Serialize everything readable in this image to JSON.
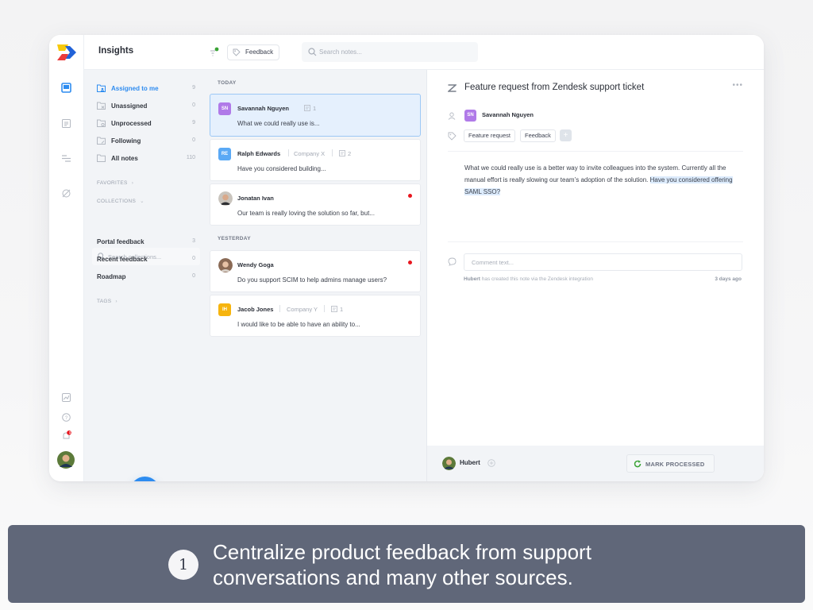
{
  "header": {
    "title": "Insights",
    "filter_chip_label": "Feedback",
    "search_placeholder": "Search notes..."
  },
  "rail": {
    "icons": [
      "inbox-icon",
      "note-icon",
      "roadmap-icon",
      "portal-icon",
      "analytics-icon",
      "help-icon",
      "notifications-icon"
    ],
    "notification_badge": "1"
  },
  "sidebar": {
    "items": [
      {
        "label": "Assigned to me",
        "count": "9",
        "icon": "folder-user-icon",
        "active": true
      },
      {
        "label": "Unassigned",
        "count": "0",
        "icon": "folder-x-icon"
      },
      {
        "label": "Unprocessed",
        "count": "9",
        "icon": "folder-circle-icon"
      },
      {
        "label": "Following",
        "count": "0",
        "icon": "folder-follow-icon"
      },
      {
        "label": "All notes",
        "count": "110",
        "icon": "folder-icon"
      }
    ],
    "favorites_label": "FAVORITES",
    "collections_label": "COLLECTIONS",
    "collections_search_placeholder": "Search collections...",
    "collections": [
      {
        "label": "Portal feedback",
        "count": "3"
      },
      {
        "label": "Recent feedback",
        "count": "0"
      },
      {
        "label": "Roadmap",
        "count": "0"
      }
    ],
    "tags_label": "TAGS",
    "add_button_label": "+"
  },
  "notes": {
    "groups": [
      {
        "label": "TODAY",
        "items": [
          {
            "initials": "SN",
            "avatar_color": "#b07ae8",
            "name": "Savannah Nguyen",
            "company": "",
            "note_count": "1",
            "snippet": "What we could really use is...",
            "selected": true,
            "unread": false
          },
          {
            "initials": "RE",
            "avatar_color": "#5aa9f5",
            "name": "Ralph Edwards",
            "company": "Company X",
            "note_count": "2",
            "snippet": "Have you considered building...",
            "selected": false,
            "unread": false
          },
          {
            "initials": "",
            "avatar_color": "photo",
            "name": "Jonatan Ivan",
            "company": "",
            "note_count": "",
            "snippet": "Our team is really loving the solution so far, but...",
            "selected": false,
            "unread": true
          }
        ]
      },
      {
        "label": "YESTERDAY",
        "items": [
          {
            "initials": "",
            "avatar_color": "photo",
            "name": "Wendy Goga",
            "company": "",
            "note_count": "",
            "snippet": "Do you support SCIM to help admins manage users?",
            "selected": false,
            "unread": true
          },
          {
            "initials": "IH",
            "avatar_color": "#f6b40e",
            "name": "Jacob Jones",
            "company": "Company Y",
            "note_count": "1",
            "snippet": "I would like to be able to have an ability to...",
            "selected": false,
            "unread": false
          }
        ]
      }
    ]
  },
  "detail": {
    "title": "Feature request from Zendesk support ticket",
    "more_label": "•••",
    "author_initials": "SN",
    "author_name": "Savannah Nguyen",
    "tags": [
      "Feature request",
      "Feedback"
    ],
    "add_tag_label": "+",
    "body_plain": "What we could really use is a better way to invite colleagues into the system. Currently all the manual effort is really slowing our team’s adoption of the solution. ",
    "body_highlight": "Have you considered offering SAML SSO?",
    "comment_placeholder": "Comment text...",
    "created_by": "Hubert",
    "created_text": " has created this note via the Zendesk integration",
    "created_ago": "3 days ago"
  },
  "footer": {
    "owner_name": "Hubert",
    "mark_processed_label": "MARK PROCESSED"
  },
  "caption": {
    "step_number": "1",
    "line1": "Centralize product feedback from support",
    "line2": "conversations and many other sources."
  },
  "colors": {
    "accent": "#2d8cf0",
    "selected_card_bg": "#e5f0fd",
    "unread_dot": "#e8161e",
    "caption_bg": "#606779",
    "processed_icon": "#3aa335"
  }
}
